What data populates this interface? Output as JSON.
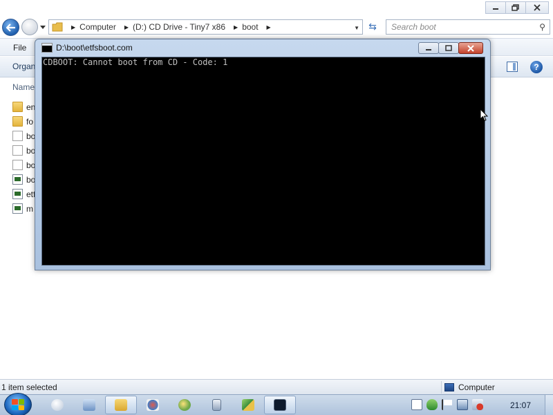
{
  "explorer": {
    "address": {
      "segments": [
        "Computer",
        "(D:) CD Drive - Tiny7 x86",
        "boot"
      ]
    },
    "search": {
      "placeholder": "Search boot"
    },
    "menu": {
      "file": "File"
    },
    "commands": {
      "organize": "Organ"
    },
    "columns": {
      "name": "Name"
    },
    "files": [
      {
        "name": "en",
        "icon": "folder-icon"
      },
      {
        "name": "fo",
        "icon": "folder-icon"
      },
      {
        "name": "bo",
        "icon": "document-icon"
      },
      {
        "name": "bo",
        "icon": "document-icon"
      },
      {
        "name": "bo",
        "icon": "document-icon"
      },
      {
        "name": "bo",
        "icon": "executable-icon"
      },
      {
        "name": "etf",
        "icon": "executable-icon"
      },
      {
        "name": "m",
        "icon": "executable-icon"
      }
    ],
    "status": {
      "selection": "1 item selected",
      "location": "Computer"
    }
  },
  "console": {
    "title": "D:\\boot\\etfsboot.com",
    "output": "CDBOOT: Cannot boot from CD - Code: 1"
  },
  "taskbar": {
    "clock": "21:07"
  },
  "colors": {
    "console_bg": "#000000",
    "console_text": "#c0c0c0",
    "taskbar": "#bccde2",
    "accent": "#1f5fae"
  }
}
